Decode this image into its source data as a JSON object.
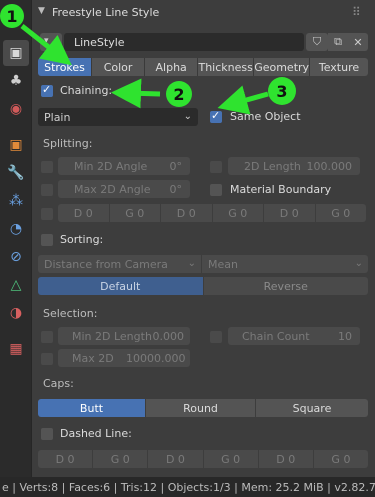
{
  "panel": {
    "title": "Freestyle Line Style",
    "linestyle_name": "LineStyle",
    "tabs": [
      "Strokes",
      "Color",
      "Alpha",
      "Thickness",
      "Geometry",
      "Texture"
    ],
    "chaining_label": "Chaining:",
    "chaining_value": "Plain",
    "same_object_label": "Same Object",
    "splitting_label": "Splitting:",
    "min_2d_angle_label": "Min 2D Angle",
    "min_2d_angle_value": "0°",
    "max_2d_angle_label": "Max 2D Angle",
    "max_2d_angle_value": "0°",
    "length_2d_label": "2D Length",
    "length_2d_value": "100.000",
    "material_boundary_label": "Material Boundary",
    "dash_cells": [
      "D 0",
      "G 0",
      "D 0",
      "G 0",
      "D 0",
      "G 0"
    ],
    "sorting_label": "Sorting:",
    "sort_key": "Distance from Camera",
    "integration": "Mean",
    "sort_order": [
      "Default",
      "Reverse"
    ],
    "selection_label": "Selection:",
    "min_2d_length_label": "Min 2D Length",
    "min_2d_length_value": "0.000",
    "max_2d_label": "Max 2D",
    "max_2d_value": "10000.000",
    "chain_count_label": "Chain Count",
    "chain_count_value": "10",
    "caps_label": "Caps:",
    "caps": [
      "Butt",
      "Round",
      "Square"
    ],
    "dashed_line_label": "Dashed Line:",
    "dashed_cells": [
      "D 0",
      "G 0",
      "D 0",
      "G 0",
      "D 0",
      "G 0"
    ]
  },
  "annotations": [
    "1",
    "2",
    "3"
  ],
  "statusbar": {
    "text": "e | Verts:8 | Faces:6 | Tris:12 | Objects:1/3 | Mem: 25.2 MiB | v2.82.7"
  },
  "colors": {
    "accent": "#4772b3",
    "annotation_green": "#2fe32f",
    "panel_bg": "#3d3d3d"
  },
  "icons": [
    "scene-icon",
    "render-icon",
    "output-icon",
    "view-layer-icon",
    "world-icon",
    "object-icon",
    "modifier-icon",
    "particles-icon",
    "physics-icon",
    "constraints-icon",
    "data-icon",
    "material-icon",
    "texture-icon"
  ]
}
